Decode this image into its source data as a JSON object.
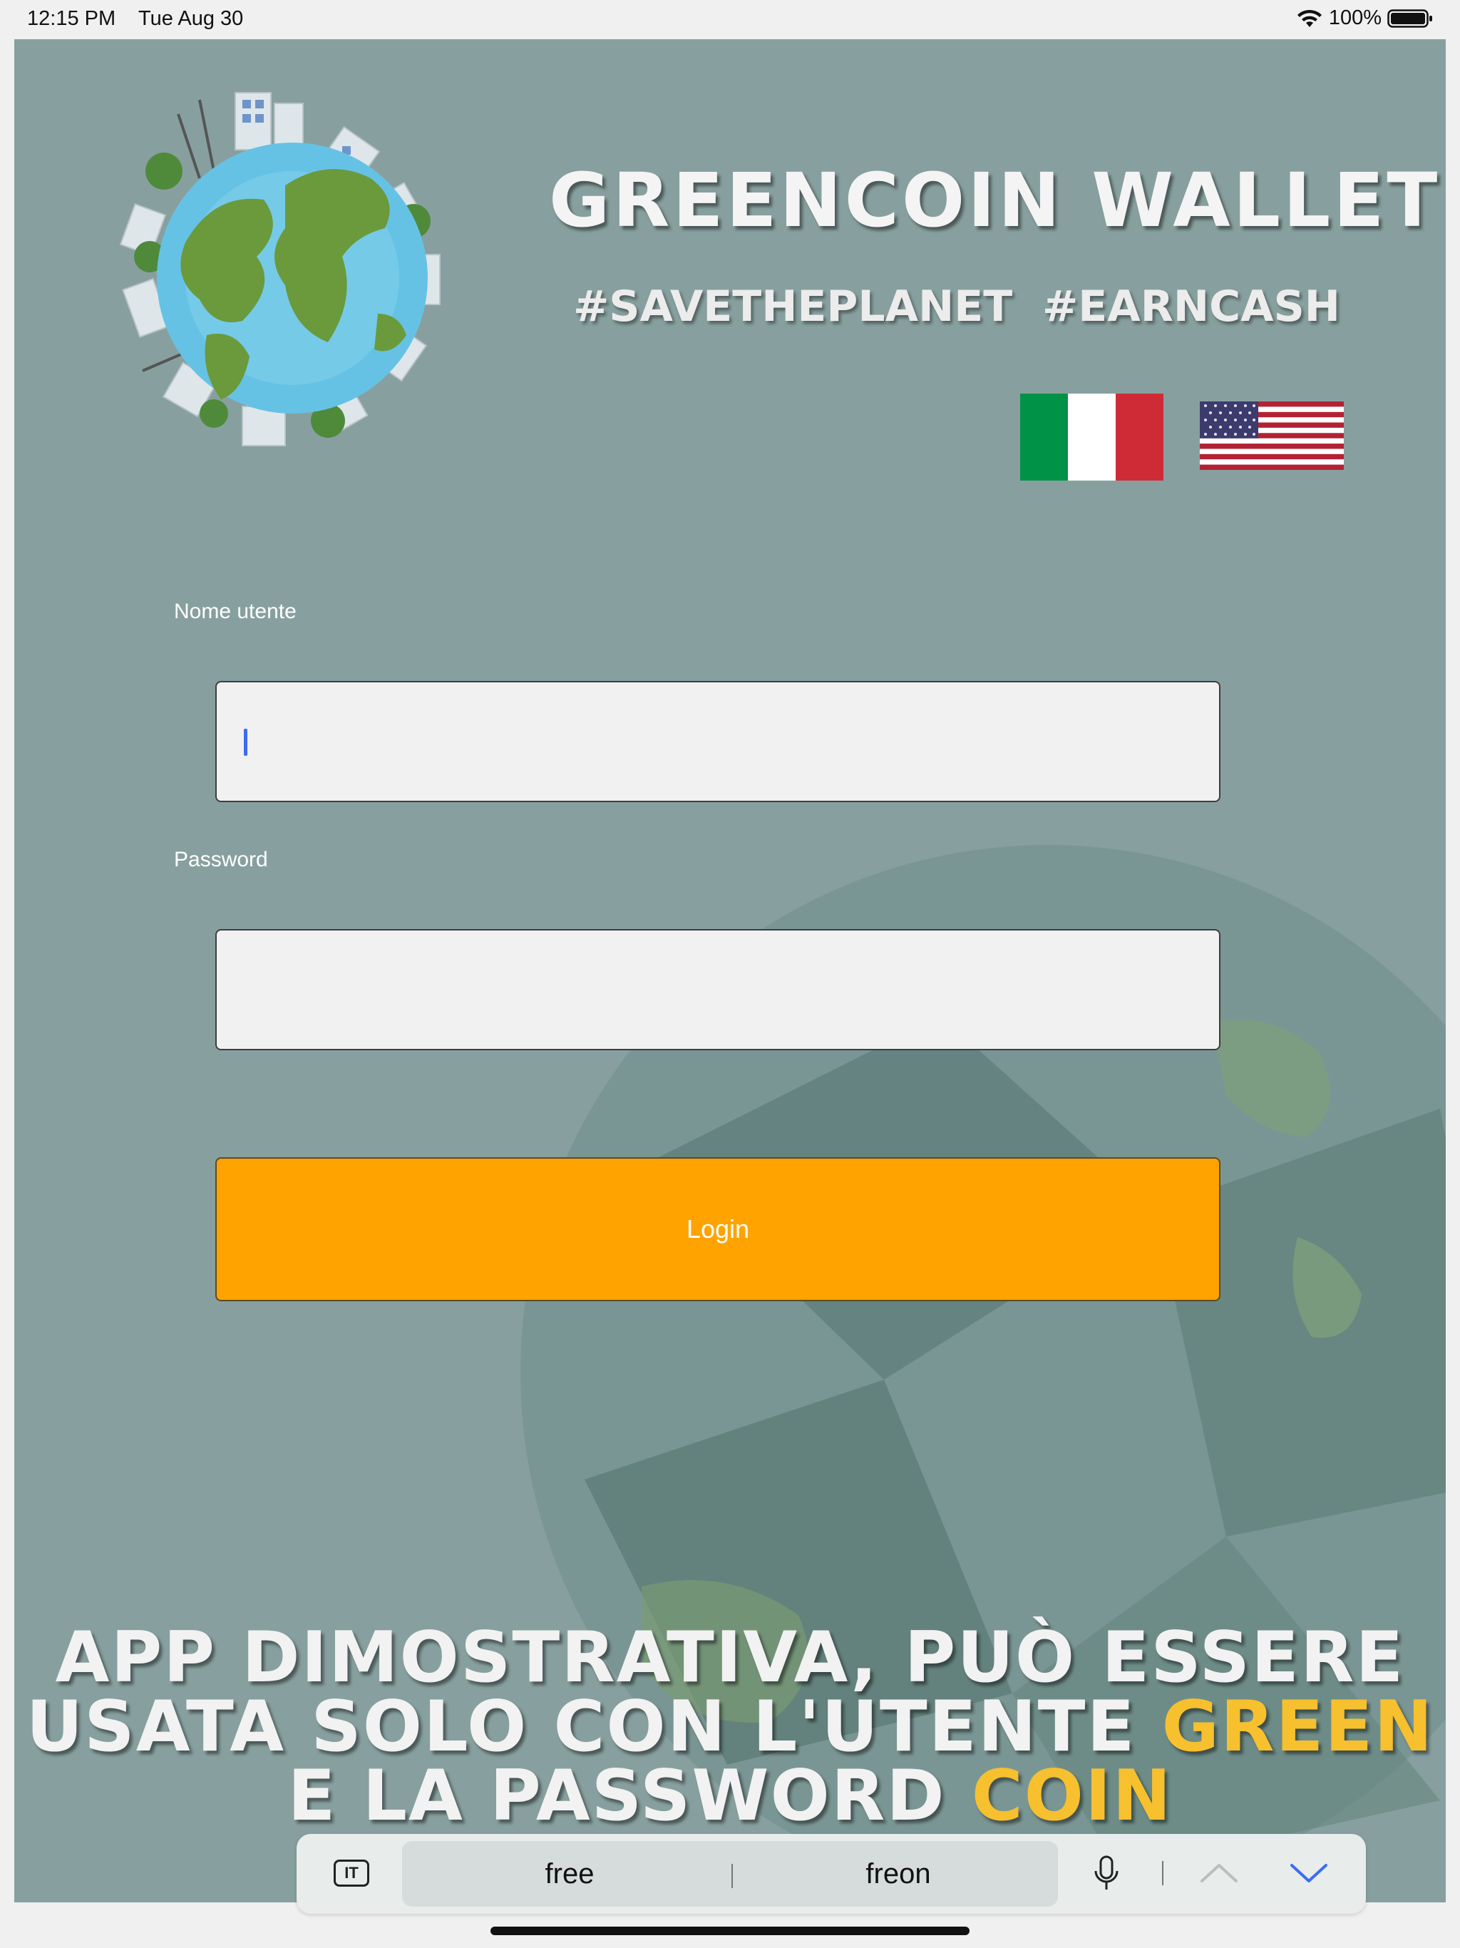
{
  "status_bar": {
    "time": "12:15 PM",
    "date": "Tue Aug 30",
    "battery_percent": "100%",
    "battery_level": 1.0,
    "icons": [
      "wifi-icon",
      "battery-icon"
    ]
  },
  "header": {
    "title": "GREENCOIN WALLET",
    "hashtag_1": "#SAVETHEPLANET",
    "hashtag_2": "#EARNCASH",
    "logo": "earth-city-globe-icon"
  },
  "language_flags": [
    {
      "name": "italian-flag-icon",
      "colors": [
        "#009246",
        "#ffffff",
        "#ce2b37"
      ]
    },
    {
      "name": "us-flag-icon",
      "colors": [
        "#b22234",
        "#ffffff",
        "#3c3b6e"
      ]
    }
  ],
  "form": {
    "username_label": "Nome utente",
    "username_value": "",
    "password_label": "Password",
    "password_value": "",
    "login_label": "Login"
  },
  "notice": {
    "line1": "APP DIMOSTRATIVA, PUÒ ESSERE",
    "line2_prefix": "USATA SOLO CON L'UTENTE ",
    "line2_highlight": "GREEN",
    "line3_prefix": "E LA PASSWORD ",
    "line3_highlight": "COIN"
  },
  "keyboard_toolbar": {
    "language": "IT",
    "suggestions": [
      "free",
      "freon"
    ],
    "icons": [
      "microphone-icon",
      "chevron-up-icon",
      "chevron-down-icon"
    ]
  },
  "colors": {
    "background": "#87a09f",
    "accent_button": "#ffa300",
    "highlight_text": "#f6c02e",
    "caret": "#3b6cf3"
  }
}
